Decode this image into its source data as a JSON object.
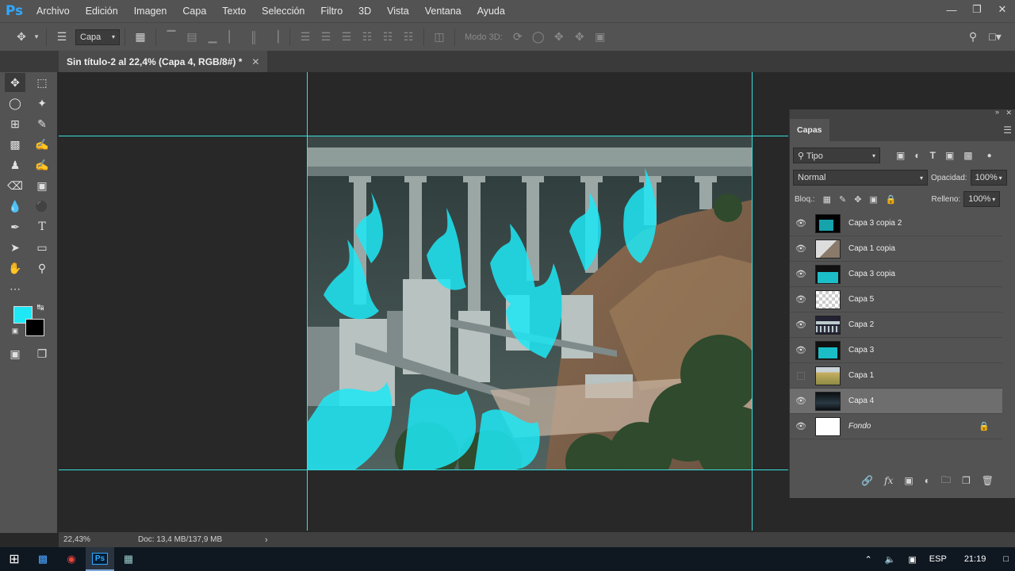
{
  "app": {
    "logo": "Ps"
  },
  "menu": [
    "Archivo",
    "Edición",
    "Imagen",
    "Capa",
    "Texto",
    "Selección",
    "Filtro",
    "3D",
    "Vista",
    "Ventana",
    "Ayuda"
  ],
  "options": {
    "auto_select_value": "Capa",
    "mode3d_label": "Modo 3D:"
  },
  "document": {
    "tab_title": "Sin título-2 al 22,4% (Capa 4, RGB/8#) *"
  },
  "status": {
    "zoom": "22,43%",
    "doc_info": "Doc: 13,4 MB/137,9 MB"
  },
  "colors": {
    "foreground": "#1ee8f5",
    "background": "#000000",
    "guides": "#35e0e0"
  },
  "layers_panel": {
    "tab": "Capas",
    "filter_label": "Tipo",
    "blend_mode": "Normal",
    "opacity_label": "Opacidad:",
    "opacity_value": "100%",
    "lock_label": "Bloq.:",
    "fill_label": "Relleno:",
    "fill_value": "100%",
    "layers": [
      {
        "name": "Capa 3 copia 2",
        "visible": true,
        "selected": false
      },
      {
        "name": "Capa 1 copia",
        "visible": true,
        "selected": false
      },
      {
        "name": "Capa 3 copia",
        "visible": true,
        "selected": false
      },
      {
        "name": "Capa 5",
        "visible": true,
        "selected": false
      },
      {
        "name": "Capa 2",
        "visible": true,
        "selected": false
      },
      {
        "name": "Capa 3",
        "visible": true,
        "selected": false
      },
      {
        "name": "Capa 1",
        "visible": false,
        "selected": false
      },
      {
        "name": "Capa 4",
        "visible": true,
        "selected": true
      },
      {
        "name": "Fondo",
        "visible": true,
        "selected": false,
        "locked": true,
        "italic": true
      }
    ]
  },
  "taskbar": {
    "language": "ESP",
    "time": "21:19"
  }
}
